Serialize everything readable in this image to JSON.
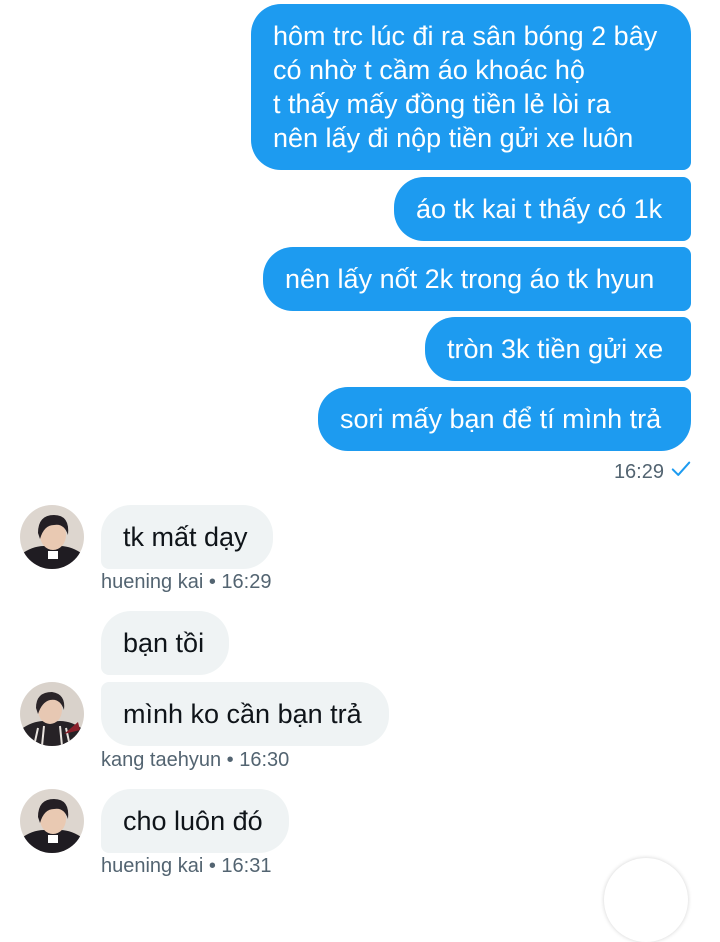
{
  "outgoing": [
    {
      "text": "hôm trc lúc đi ra sân bóng 2 bây\ncó nhờ t cầm áo khoác hộ\nt thấy mấy đồng tiền lẻ lòi ra\nnên lấy đi nộp tiền gửi xe luôn"
    },
    {
      "text": "áo tk kai t thấy có 1k"
    },
    {
      "text": "nên lấy nốt 2k trong áo tk hyun"
    },
    {
      "text": "tròn 3k tiền gửi xe"
    },
    {
      "text": "sori mấy bạn để tí mình trả"
    }
  ],
  "outgoing_meta": {
    "time": "16:29",
    "status_icon": "check-icon"
  },
  "incoming": [
    {
      "text": "tk mất dạy",
      "meta": "huening kai • 16:29"
    },
    {
      "text": "bạn tồi"
    },
    {
      "text": "mình ko cần bạn trả",
      "meta": "kang taehyun • 16:30"
    },
    {
      "text": "cho luôn đó",
      "meta": "huening kai • 16:31"
    }
  ],
  "colors": {
    "outgoing_bubble": "#1d9bf0",
    "incoming_bubble": "#eff3f4",
    "meta_text": "#536471"
  }
}
